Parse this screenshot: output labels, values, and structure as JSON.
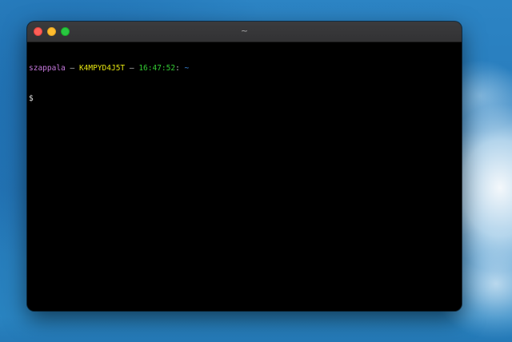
{
  "window": {
    "title": "~"
  },
  "prompt": {
    "user": "szappala",
    "separator1": " – ",
    "host": "K4MPYD4J5T",
    "separator2": " – ",
    "time": "16:47:52",
    "colon": ": ",
    "cwd": "~",
    "symbol": "$"
  },
  "colors": {
    "user": "#c678dd",
    "host": "#e5e510",
    "time": "#33cc33",
    "cwd": "#3b8eea",
    "terminal_background": "#000000"
  },
  "icons": {
    "close": "close-dot-icon",
    "minimize": "minimize-dot-icon",
    "zoom": "zoom-dot-icon"
  }
}
